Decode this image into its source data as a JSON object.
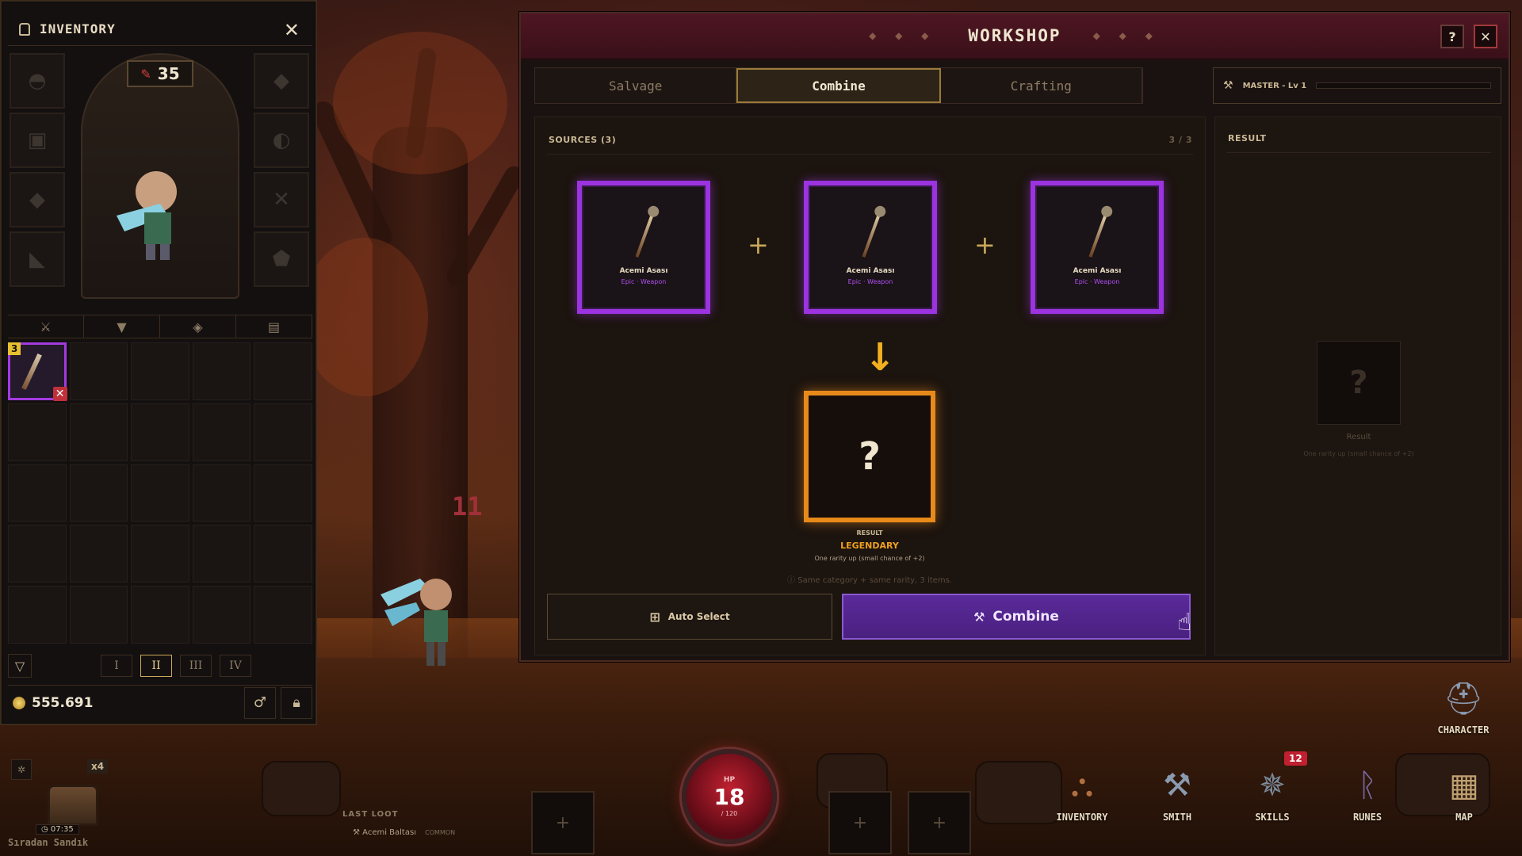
{
  "inventory": {
    "title": "INVENTORY",
    "close_icon": "close-icon",
    "level": "35",
    "item_count": "3",
    "filter_tabs": [
      "weapon-icon",
      "armor-icon",
      "gem-icon",
      "scroll-icon"
    ],
    "pages": [
      "I",
      "II",
      "III",
      "IV"
    ],
    "active_page": "II",
    "gold": "555.691"
  },
  "workshop": {
    "title": "WORKSHOP",
    "help_label": "?",
    "close_label": "✕",
    "tabs": [
      {
        "label": "Salvage",
        "active": false
      },
      {
        "label": "Combine",
        "active": true
      },
      {
        "label": "Crafting",
        "active": false
      }
    ],
    "mastery": {
      "label": "MASTER - Lv 1",
      "progress": 0
    },
    "sources": {
      "label": "SOURCES (3)",
      "count": "3 / 3",
      "items": [
        {
          "name": "Acemi Asası",
          "sub": "Epic · Weapon"
        },
        {
          "name": "Acemi Asası",
          "sub": "Epic · Weapon"
        },
        {
          "name": "Acemi Asası",
          "sub": "Epic · Weapon"
        }
      ]
    },
    "result": {
      "symbol": "?",
      "label": "RESULT",
      "rarity": "LEGENDARY",
      "desc": "One rarity up (small chance of +2)"
    },
    "hint": "Same category + same rarity, 3 items.",
    "auto_select": "Auto Select",
    "combine": "Combine",
    "result_panel": {
      "title": "RESULT",
      "symbol": "?",
      "label": "Result",
      "desc": "One rarity up (small chance of +2)"
    }
  },
  "hud": {
    "damage_text": "11",
    "hp": {
      "label": "HP",
      "value": "18",
      "max": "/ 120"
    },
    "last_loot_label": "LAST LOOT",
    "last_loot_item": "Acemi Baltası",
    "last_loot_rarity": "COMMON",
    "chest": {
      "multiplier": "x4",
      "timer": "07:35",
      "name": "Sıradan Sandık"
    },
    "buttons": [
      {
        "label": "CHARACTER",
        "icon": "helmet-icon"
      },
      {
        "label": "INVENTORY",
        "icon": "backpack-icon"
      },
      {
        "label": "SMITH",
        "icon": "anvil-icon"
      },
      {
        "label": "SKILLS",
        "icon": "wheel-icon"
      },
      {
        "label": "RUNES",
        "icon": "rune-icon"
      },
      {
        "label": "MAP",
        "icon": "map-icon"
      }
    ],
    "skills_badge": "12",
    "slot_plus": "+"
  },
  "colors": {
    "epic": "#9b33e0",
    "legendary": "#e88a1a",
    "combine_button": "#4a2080",
    "hp": "#c02030"
  }
}
